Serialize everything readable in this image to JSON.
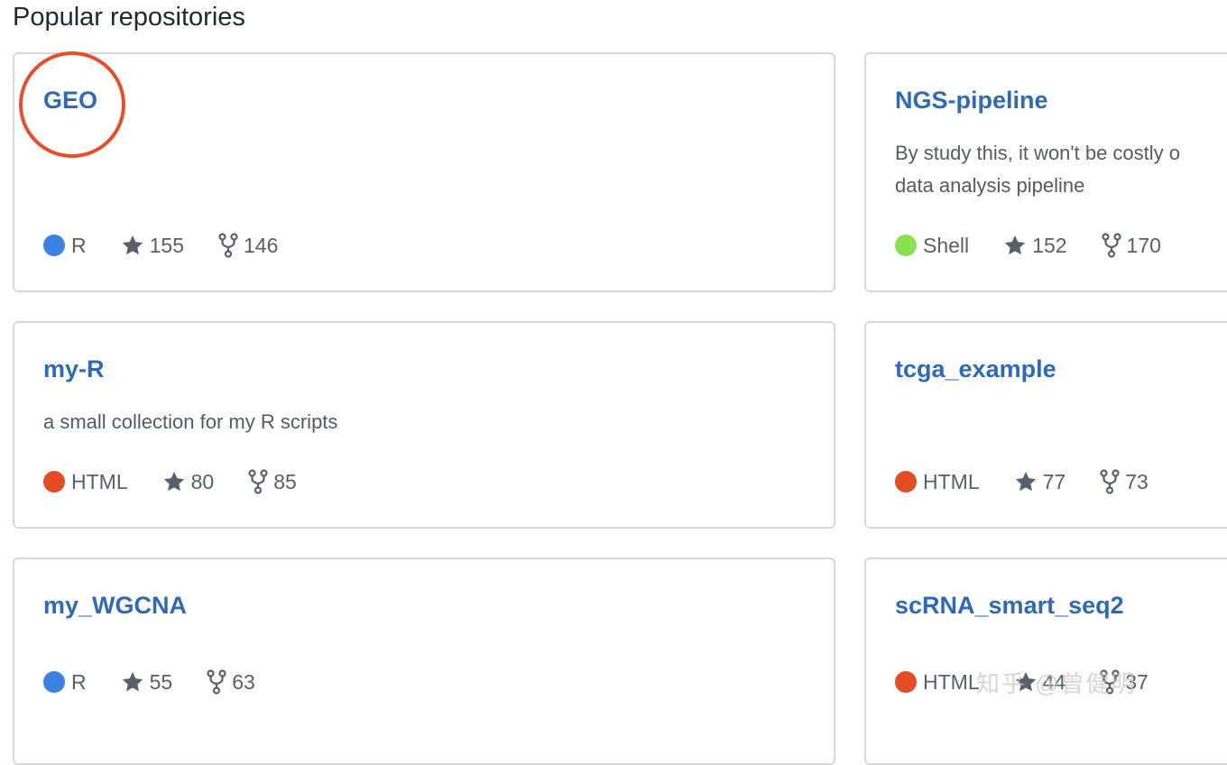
{
  "section": {
    "title": "Popular repositories"
  },
  "repos": [
    {
      "name": "GEO",
      "description": "",
      "language": "R",
      "lang_color": "#3b82e0",
      "stars": "155",
      "forks": "146"
    },
    {
      "name": "NGS-pipeline",
      "description": "By study this, it won't be costly o\ndata analysis pipeline",
      "language": "Shell",
      "lang_color": "#89e051",
      "stars": "152",
      "forks": "170"
    },
    {
      "name": "my-R",
      "description": "a small collection for my R scripts",
      "language": "HTML",
      "lang_color": "#e34c26",
      "stars": "80",
      "forks": "85"
    },
    {
      "name": "tcga_example",
      "description": "",
      "language": "HTML",
      "lang_color": "#e34c26",
      "stars": "77",
      "forks": "73"
    },
    {
      "name": "my_WGCNA",
      "description": "",
      "language": "R",
      "lang_color": "#3b82e0",
      "stars": "55",
      "forks": "63"
    },
    {
      "name": "scRNA_smart_seq2",
      "description": "",
      "language": "HTML",
      "lang_color": "#e34c26",
      "stars": "44",
      "forks": "37"
    }
  ],
  "watermark": "知乎 @曾健明",
  "colors": {
    "link": "#2f6ab3",
    "highlight": "#e0522e",
    "border": "#d5d9de"
  }
}
